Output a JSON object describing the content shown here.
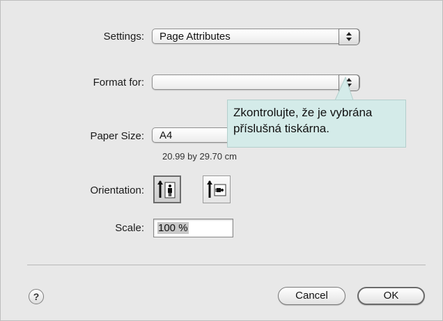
{
  "dialog": {
    "settings": {
      "label": "Settings:",
      "value": "Page Attributes"
    },
    "format_for": {
      "label": "Format for:",
      "value": ""
    },
    "paper_size": {
      "label": "Paper Size:",
      "value": "A4",
      "dimensions": "20.99 by 29.70 cm"
    },
    "orientation": {
      "label": "Orientation:",
      "options": [
        {
          "name": "portrait",
          "icon": "portrait-orientation-icon",
          "selected": true
        },
        {
          "name": "landscape",
          "icon": "landscape-orientation-icon",
          "selected": false
        }
      ]
    },
    "scale": {
      "label": "Scale:",
      "value": "100 %"
    },
    "help": {
      "glyph": "?"
    },
    "buttons": {
      "cancel": "Cancel",
      "ok": "OK"
    }
  },
  "callout": {
    "line1": "Zkontrolujte, že je vybrána",
    "line2": "příslušná tiskárna."
  },
  "colors": {
    "dialog_bg": "#e8e8e8",
    "callout_bg": "#d4ebe9"
  }
}
